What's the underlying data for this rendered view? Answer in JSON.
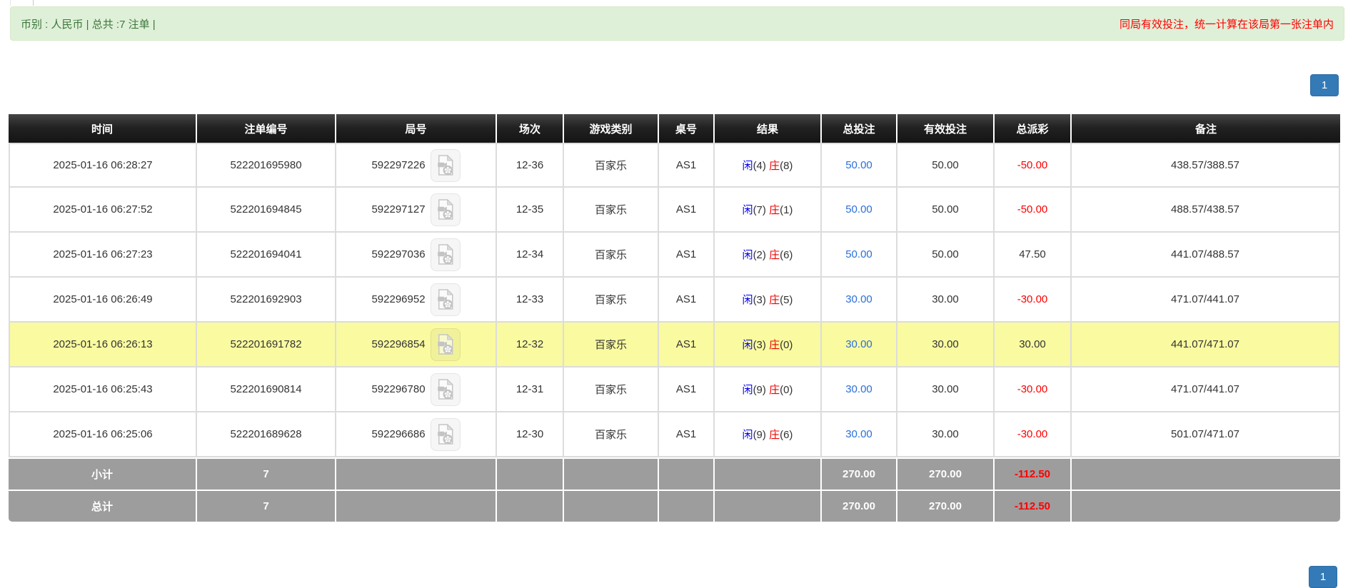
{
  "banner": {
    "left_text": "币别 : 人民币 | 总共 :7 注单 |",
    "right_text": "同局有效投注，统一计算在该局第一张注单内"
  },
  "pagination": {
    "page": "1"
  },
  "icons": {
    "video_replay": "film-document-icon"
  },
  "colors": {
    "banner_bg": "#dff0d8",
    "banner_text_green": "#3c763d",
    "alert_red": "#ff0000",
    "header_bg": "#1c1c1c",
    "page_active_bg": "#337ab7",
    "highlight_row": "#fafaa0",
    "footer_bg": "#9d9d9d",
    "amount_link_blue": "#2a6fdb",
    "player_blue": "#0000ee",
    "banker_red": "#ee0000"
  },
  "table": {
    "headers": [
      "时间",
      "注单编号",
      "局号",
      "场次",
      "游戏类别",
      "桌号",
      "结果",
      "总投注",
      "有效投注",
      "总派彩",
      "备注"
    ],
    "result_labels": {
      "player": "闲",
      "banker": "庄"
    },
    "rows": [
      {
        "time": "2025-01-16 06:28:27",
        "bet_id": "522201695980",
        "round_id": "592297226",
        "session": "12-36",
        "game": "百家乐",
        "table_id": "AS1",
        "player_count": "(4)",
        "banker_count": "(8)",
        "total_bet": "50.00",
        "valid_bet": "50.00",
        "payout": "-50.00",
        "remark": "438.57/388.57",
        "highlight": false
      },
      {
        "time": "2025-01-16 06:27:52",
        "bet_id": "522201694845",
        "round_id": "592297127",
        "session": "12-35",
        "game": "百家乐",
        "table_id": "AS1",
        "player_count": "(7)",
        "banker_count": "(1)",
        "total_bet": "50.00",
        "valid_bet": "50.00",
        "payout": "-50.00",
        "remark": "488.57/438.57",
        "highlight": false
      },
      {
        "time": "2025-01-16 06:27:23",
        "bet_id": "522201694041",
        "round_id": "592297036",
        "session": "12-34",
        "game": "百家乐",
        "table_id": "AS1",
        "player_count": "(2)",
        "banker_count": "(6)",
        "total_bet": "50.00",
        "valid_bet": "50.00",
        "payout": "47.50",
        "remark": "441.07/488.57",
        "highlight": false
      },
      {
        "time": "2025-01-16 06:26:49",
        "bet_id": "522201692903",
        "round_id": "592296952",
        "session": "12-33",
        "game": "百家乐",
        "table_id": "AS1",
        "player_count": "(3)",
        "banker_count": "(5)",
        "total_bet": "30.00",
        "valid_bet": "30.00",
        "payout": "-30.00",
        "remark": "471.07/441.07",
        "highlight": false
      },
      {
        "time": "2025-01-16 06:26:13",
        "bet_id": "522201691782",
        "round_id": "592296854",
        "session": "12-32",
        "game": "百家乐",
        "table_id": "AS1",
        "player_count": "(3)",
        "banker_count": "(0)",
        "total_bet": "30.00",
        "valid_bet": "30.00",
        "payout": "30.00",
        "remark": "441.07/471.07",
        "highlight": true
      },
      {
        "time": "2025-01-16 06:25:43",
        "bet_id": "522201690814",
        "round_id": "592296780",
        "session": "12-31",
        "game": "百家乐",
        "table_id": "AS1",
        "player_count": "(9)",
        "banker_count": "(0)",
        "total_bet": "30.00",
        "valid_bet": "30.00",
        "payout": "-30.00",
        "remark": "471.07/441.07",
        "highlight": false
      },
      {
        "time": "2025-01-16 06:25:06",
        "bet_id": "522201689628",
        "round_id": "592296686",
        "session": "12-30",
        "game": "百家乐",
        "table_id": "AS1",
        "player_count": "(9)",
        "banker_count": "(6)",
        "total_bet": "30.00",
        "valid_bet": "30.00",
        "payout": "-30.00",
        "remark": "501.07/471.07",
        "highlight": false
      }
    ],
    "subtotal": {
      "label": "小计",
      "count": "7",
      "total_bet": "270.00",
      "valid_bet": "270.00",
      "payout": "-112.50"
    },
    "total": {
      "label": "总计",
      "count": "7",
      "total_bet": "270.00",
      "valid_bet": "270.00",
      "payout": "-112.50"
    }
  }
}
